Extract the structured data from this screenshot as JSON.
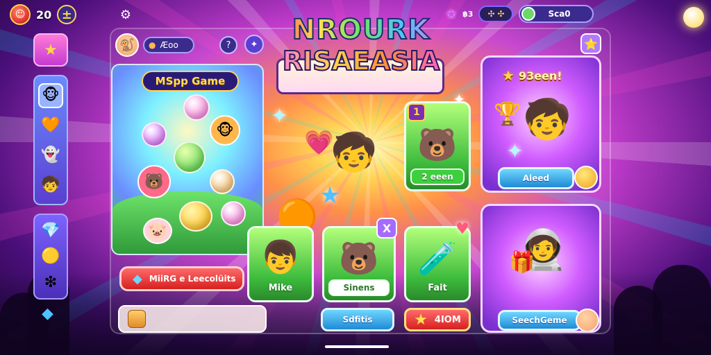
{
  "topbar": {
    "count": "20",
    "plus": "±",
    "right_text": "฿3",
    "search_label": "Sca0",
    "colors": {
      "accent": "#ffd54f",
      "panel": "#3b2c8c"
    }
  },
  "logo": {
    "line1": "NROURK",
    "line2": "RISAEASIA"
  },
  "profile": {
    "name": "Æoo"
  },
  "game_panel": {
    "title": "MSpp Game"
  },
  "buttons": {
    "play": "MiiRG e Leecolüits",
    "blue_center": "Sdfitis",
    "red_amount": "4IOM",
    "right_top": "Aleed",
    "right_bottom": "SeechGeme"
  },
  "cards": {
    "top_label": "2 eeen",
    "small1_label": "Mike",
    "small2_label": "Sinens",
    "small3_label": "Fait",
    "top_badge": "1",
    "small2_badge": "X"
  },
  "right_cards": {
    "top_title": "93een!"
  },
  "icons": [
    "coin-icon",
    "plus-icon",
    "gear-icon",
    "star-icon",
    "menu-icon",
    "sidebar-star-icon",
    "character-icon",
    "gem-icon",
    "question-icon"
  ]
}
